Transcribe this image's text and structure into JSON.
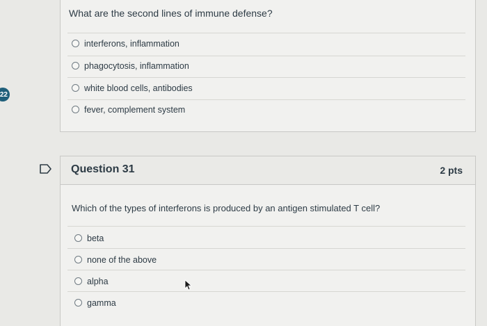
{
  "sidebar": {
    "question_badge": "22"
  },
  "question_30": {
    "text": "What are the second lines of immune defense?",
    "answers": [
      "interferons, inflammation",
      "phagocytosis, inflammation",
      "white blood cells, antibodies",
      "fever, complement system"
    ]
  },
  "question_31": {
    "title": "Question 31",
    "points": "2 pts",
    "text": "Which of the types of interferons is produced by an antigen stimulated T cell?",
    "answers": [
      "beta",
      "none of the above",
      "alpha",
      "gamma"
    ]
  },
  "icons": {
    "flag": "flag-icon",
    "cursor": "mouse-cursor-icon"
  },
  "colors": {
    "badge": "#1f5f7a",
    "background": "#e9e9e6",
    "card": "#f1f1ef"
  }
}
